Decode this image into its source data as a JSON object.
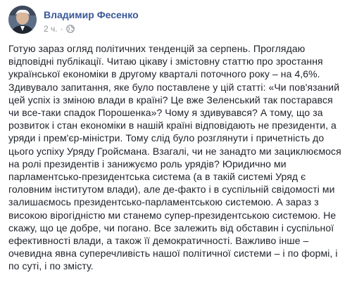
{
  "post": {
    "author": "Владимир Фесенко",
    "time": "2 ч.",
    "separator": "·",
    "privacy_icon": "globe-icon",
    "text": "Готую зараз огляд політичних тенденцій за серпень. Проглядаю відповідні публікації. Читаю цікаву і змістовну статтю про зростання української економіки в другому кварталі поточного року – на 4,6%. Здивувало запитання, яке було поставлене у цій статті: «Чи пов'язаний цей успіх із зміною влади в країні? Це вже Зеленський так постарався чи все-таки спадок Порошенка»? Чому я здивувався? А тому, що за розвиток і стан економіки в нашій країні відповідають не президенти, а уряди і прем'єр-міністри. Тому слід було розглянути і причетність до цього успіху Уряду Гройсмана. Взагалі, чи не занадто ми зациклюємося на ролі президентів і занижуємо роль урядів? Юридично ми парламентсько-президентська система (а в такій системі Уряд є головним інститутом влади), але де-факто і в суспільній свідомості ми залишаємось президентсько-парламентською системою. А зараз з високою вірогідністю ми станемо супер-президентською системою. Не скажу, що це добре, чи погано. Все залежить від обставин і суспільної ефективності влади, а також її демократичності. Важливо інше – очевидна явна суперечливість нашої політичної системи – і по формі, і по суті, і по змісту."
  }
}
